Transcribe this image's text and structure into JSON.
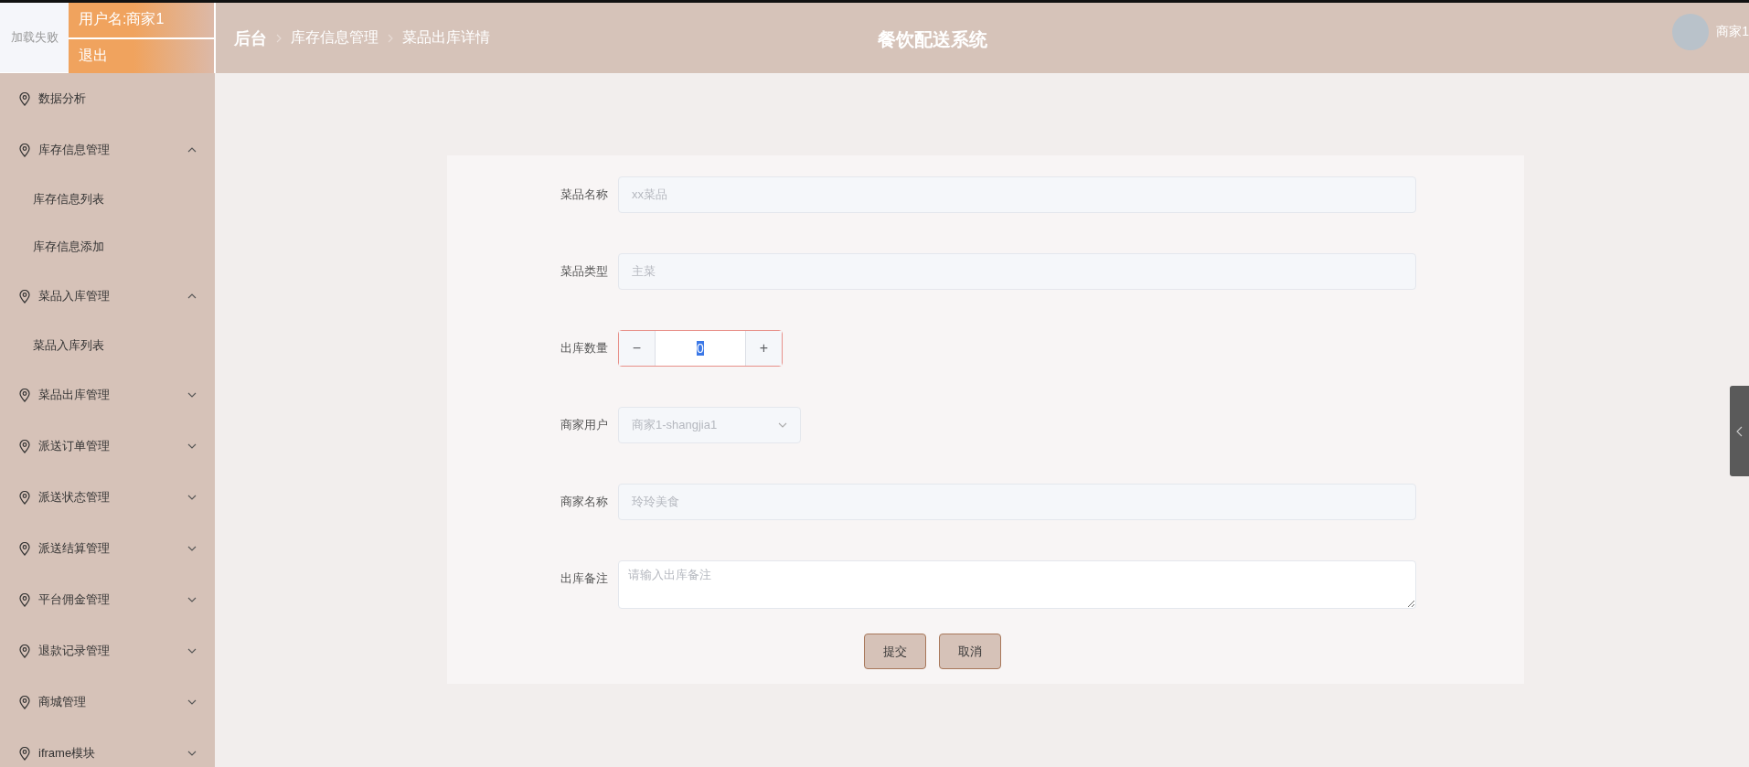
{
  "header": {
    "logo_text": "加载失败",
    "username": "用户名:商家1",
    "logout": "退出",
    "breadcrumb": [
      "后台",
      "库存信息管理",
      "菜品出库详情"
    ],
    "title": "餐饮配送系统",
    "user": "商家1"
  },
  "sidebar": {
    "items": [
      {
        "label": "数据分析",
        "kind": "leaf"
      },
      {
        "label": "库存信息管理",
        "kind": "group",
        "expanded": true,
        "children": [
          {
            "label": "库存信息列表"
          },
          {
            "label": "库存信息添加"
          }
        ]
      },
      {
        "label": "菜品入库管理",
        "kind": "group",
        "expanded": true,
        "children": [
          {
            "label": "菜品入库列表"
          }
        ]
      },
      {
        "label": "菜品出库管理",
        "kind": "group",
        "expanded": false
      },
      {
        "label": "派送订单管理",
        "kind": "group",
        "expanded": false
      },
      {
        "label": "派送状态管理",
        "kind": "group",
        "expanded": false
      },
      {
        "label": "派送结算管理",
        "kind": "group",
        "expanded": false
      },
      {
        "label": "平台佣金管理",
        "kind": "group",
        "expanded": false
      },
      {
        "label": "退款记录管理",
        "kind": "group",
        "expanded": false
      },
      {
        "label": "商城管理",
        "kind": "group",
        "expanded": false
      },
      {
        "label": "iframe模块",
        "kind": "group",
        "expanded": false
      }
    ]
  },
  "form": {
    "fields": [
      {
        "label": "菜品名称",
        "kind": "text",
        "value": "xx菜品",
        "disabled": true
      },
      {
        "label": "菜品类型",
        "kind": "text",
        "value": "主菜",
        "disabled": true
      },
      {
        "label": "出库数量",
        "kind": "number",
        "value": "0",
        "minus": "−",
        "plus": "+",
        "focused": true,
        "text_selected": true
      },
      {
        "label": "商家用户",
        "kind": "select",
        "value": "商家1-shangjia1",
        "disabled": true
      },
      {
        "label": "商家名称",
        "kind": "text",
        "value": "玲玲美食",
        "disabled": true
      },
      {
        "label": "出库备注",
        "kind": "textarea",
        "placeholder": "请输入出库备注"
      }
    ],
    "buttons": [
      "提交",
      "取消"
    ]
  }
}
